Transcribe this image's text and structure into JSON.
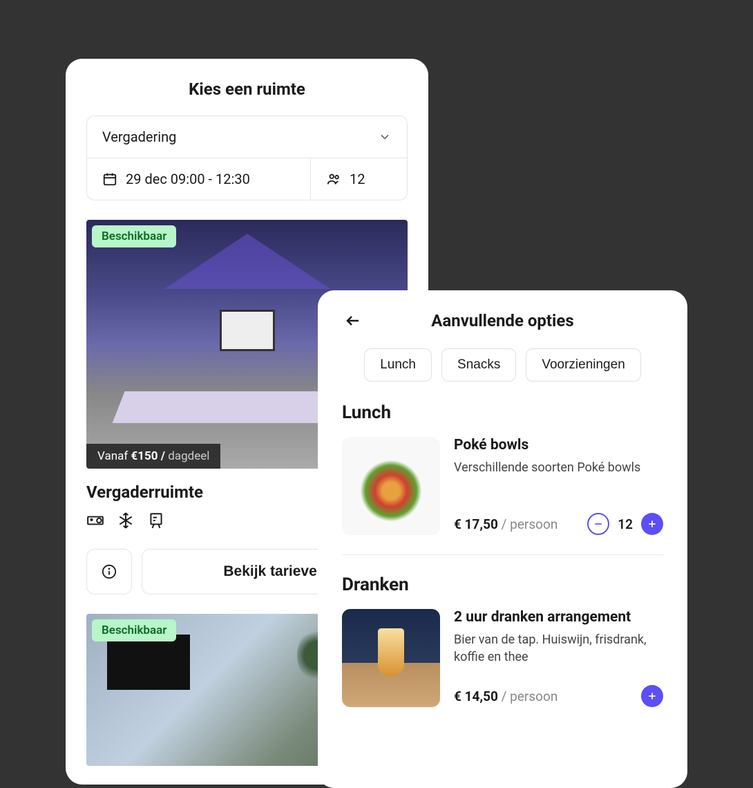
{
  "colors": {
    "accent": "#5b4ff5",
    "badge_bg": "#b8f5c8",
    "badge_text": "#0a6b2a"
  },
  "rooms_card": {
    "title": "Kies een ruimte",
    "type_select": "Vergadering",
    "date_time": "29 dec 09:00 - 12:30",
    "people": "12",
    "rooms": [
      {
        "badge": "Beschikbaar",
        "price_prefix": "Vanaf",
        "price_amount": "€150 /",
        "price_unit": "dagdeel",
        "name": "Vergaderruimte"
      },
      {
        "badge": "Beschikbaar"
      }
    ],
    "info_button": "i",
    "view_rates": "Bekijk tarieven"
  },
  "options_card": {
    "title": "Aanvullende opties",
    "tabs": [
      "Lunch",
      "Snacks",
      "Voorzieningen"
    ],
    "sections": [
      {
        "heading": "Lunch",
        "items": [
          {
            "name": "Poké bowls",
            "desc": "Verschillende soorten Poké bowls",
            "price": "€ 17,50",
            "per": "/ persoon",
            "qty": "12"
          }
        ]
      },
      {
        "heading": "Dranken",
        "items": [
          {
            "name": "2 uur dranken arrangement",
            "desc": "Bier van de tap. Huiswijn, frisdrank, koffie en thee",
            "price": "€ 14,50",
            "per": "/ persoon"
          }
        ]
      }
    ]
  }
}
